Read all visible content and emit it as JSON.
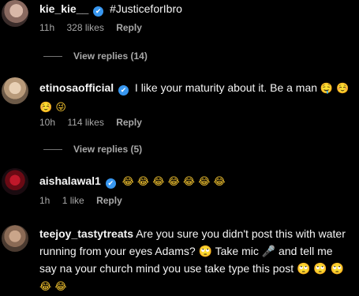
{
  "comments": [
    {
      "user": "kie_kie__",
      "text": "#JusticeforIbro",
      "time": "11h",
      "likes": "328 likes",
      "reply": "Reply",
      "view_replies": "View replies (14)",
      "verified": true
    },
    {
      "user": "etinosaofficial",
      "text": "I like your maturity about it. Be a man",
      "emoji_line1": "🤤 ☺️",
      "emoji_line2": "☺️ 😜",
      "time": "10h",
      "likes": "114 likes",
      "reply": "Reply",
      "view_replies": "View replies (5)",
      "verified": true
    },
    {
      "user": "aishalawal1",
      "emojis": "😂 😂 😂 😂 😂 😂 😂",
      "time": "1h",
      "likes": "1 like",
      "reply": "Reply",
      "verified": true
    },
    {
      "user": "teejoy_tastytreats",
      "text_line1": "Are you sure you didn't post this with water",
      "text_line2": "running from your eyes Adams? 🙄 Take mic 🎤 and tell me",
      "text_line3": "say na your church mind you use take type this post 🙄 🙄 🙄",
      "emoji_line4": "😂 😂",
      "verified": false
    }
  ],
  "icons": {
    "verified": "✔"
  },
  "colors": {
    "verified": "#3897f0",
    "meta": "#a8a8a8"
  }
}
